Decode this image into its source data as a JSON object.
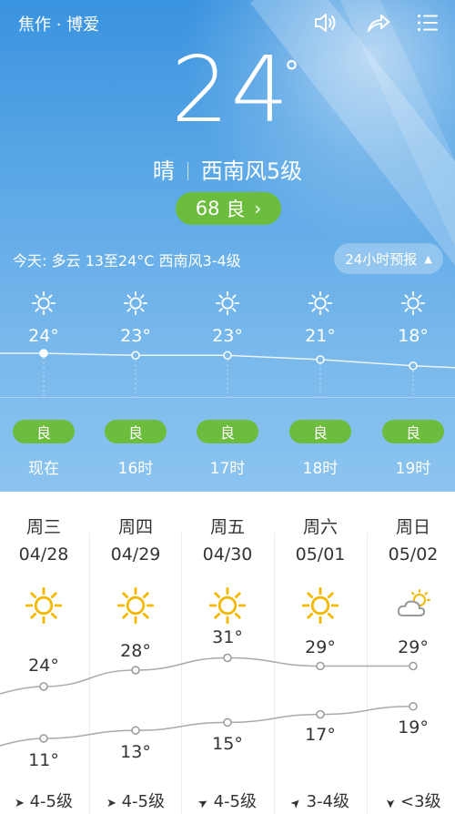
{
  "header": {
    "city": "焦作 · 博爱",
    "icons": [
      "speaker-icon",
      "share-icon",
      "menu-icon"
    ]
  },
  "current": {
    "temperature": "24",
    "degree_symbol": "°",
    "condition": "晴",
    "wind": "西南风5级",
    "aqi_value": "68",
    "aqi_level": "良",
    "aqi_chevron": "›"
  },
  "today": {
    "summary": "今天: 多云  13至24°C  西南风3-4级",
    "forecast_button": "24小时预报",
    "forecast_button_arrow": "▲"
  },
  "hourly": [
    {
      "temp": "24°",
      "aqi": "良",
      "time": "现在",
      "icon": "sun-icon"
    },
    {
      "temp": "23°",
      "aqi": "良",
      "time": "16时",
      "icon": "sun-icon"
    },
    {
      "temp": "23°",
      "aqi": "良",
      "time": "17时",
      "icon": "sun-icon"
    },
    {
      "temp": "21°",
      "aqi": "良",
      "time": "18时",
      "icon": "sun-icon"
    },
    {
      "temp": "18°",
      "aqi": "良",
      "time": "19时",
      "icon": "sun-icon"
    }
  ],
  "daily": [
    {
      "day": "周三",
      "date": "04/28",
      "icon": "sun-icon",
      "high": "24°",
      "low": "11°",
      "wind_dir": "➤",
      "wind": "4-5级"
    },
    {
      "day": "周四",
      "date": "04/29",
      "icon": "sun-icon",
      "high": "28°",
      "low": "13°",
      "wind_dir": "➤",
      "wind": "4-5级"
    },
    {
      "day": "周五",
      "date": "04/30",
      "icon": "sun-icon",
      "high": "31°",
      "low": "15°",
      "wind_dir": "➤",
      "wind": "4-5级"
    },
    {
      "day": "周六",
      "date": "05/01",
      "icon": "sun-icon",
      "high": "29°",
      "low": "17°",
      "wind_dir": "➤",
      "wind": "3-4级"
    },
    {
      "day": "周日",
      "date": "05/02",
      "icon": "cloud-sun-icon",
      "high": "29°",
      "low": "19°",
      "wind_dir": "➤",
      "wind": "<3级"
    }
  ],
  "colors": {
    "sky_top": "#3a93df",
    "sky_bottom": "#8cc4ef",
    "aqi_good": "#6cbd3d",
    "sun": "#f5b800"
  }
}
